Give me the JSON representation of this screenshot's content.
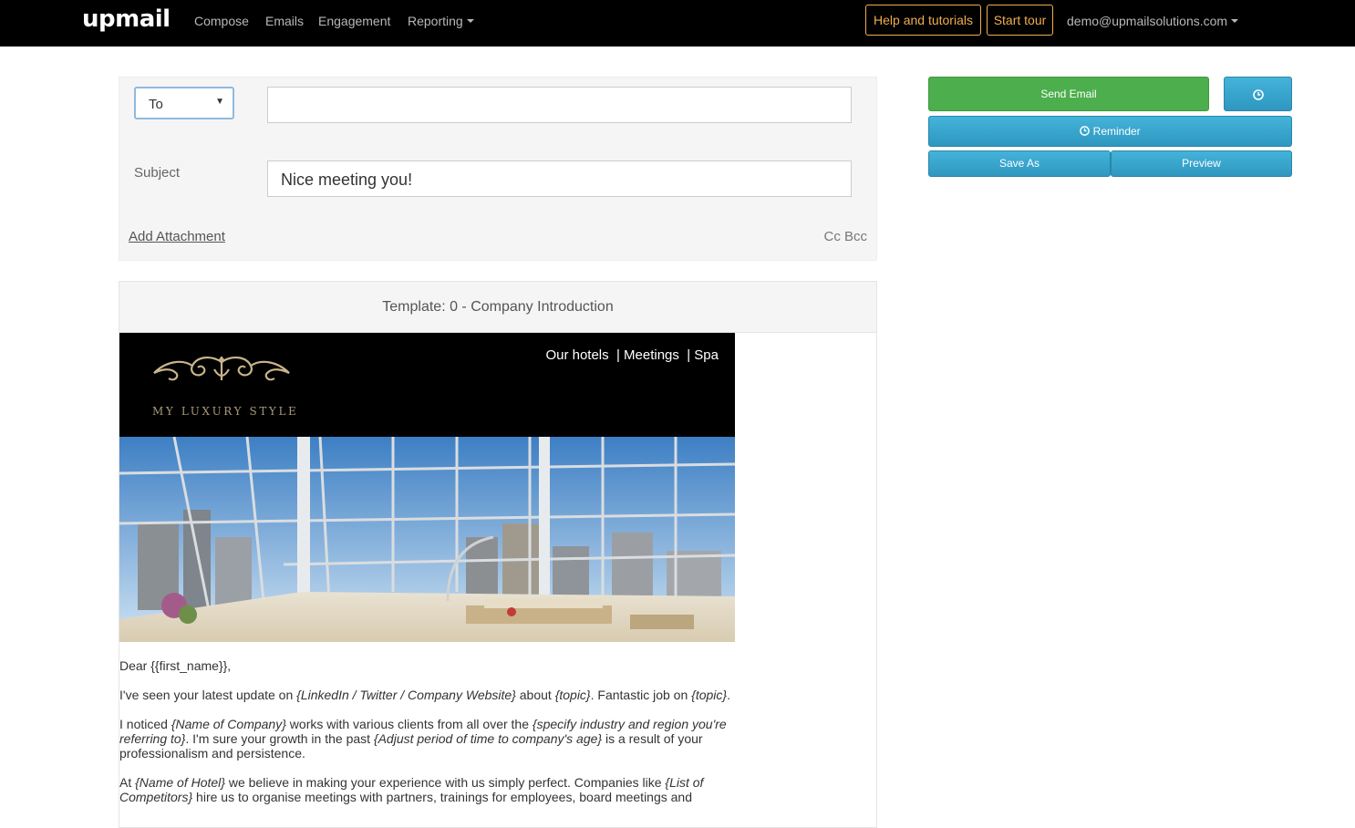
{
  "nav": {
    "logo": "upmail",
    "links": [
      "Compose",
      "Emails",
      "Engagement",
      "Reporting"
    ],
    "help": "Help and tutorials",
    "tour": "Start tour",
    "account": "demo@upmailsolutions.com"
  },
  "compose": {
    "recipient_type": "To",
    "to_value": "",
    "subject_label": "Subject",
    "subject_value": "Nice meeting you!",
    "add_attachment": "Add Attachment",
    "cc_bcc": "Cc Bcc"
  },
  "actions": {
    "send": "Send Email",
    "reminder": "Reminder",
    "save_as": "Save As",
    "preview": "Preview"
  },
  "template": {
    "title": "Template: 0 - Company Introduction",
    "email_nav": "Our hotels  | Meetings  | Spa",
    "brand": "MY LUXURY STYLE",
    "greeting": "Dear {{first_name}},",
    "p1_a": "I've seen your latest update on ",
    "p1_b": "{LinkedIn / Twitter / Company Website}",
    "p1_c": " about ",
    "p1_d": "{topic}",
    "p1_e": ". Fantastic job on ",
    "p1_f": "{topic}",
    "p1_g": ".",
    "p2_a": "I noticed ",
    "p2_b": "{Name of Company}",
    "p2_c": " works with various clients from all over the ",
    "p2_d": "{specify industry and region you're referring to}",
    "p2_e": ". I'm sure your growth in the past ",
    "p2_f": "{Adjust period of time to company's age}",
    "p2_g": " is a result of your professionalism and persistence.",
    "p3_a": "At ",
    "p3_b": "{Name of Hotel}",
    "p3_c": " we believe in making your experience with us simply perfect. Companies like ",
    "p3_d": "{List of Competitors}",
    "p3_e": " hire us to organise meetings with partners, trainings for employees, board meetings and"
  },
  "colors": {
    "nav_bg": "#000000",
    "accent_orange": "#f0ad4e",
    "send_green": "#4cae4c",
    "button_blue": "#33a3cc"
  }
}
